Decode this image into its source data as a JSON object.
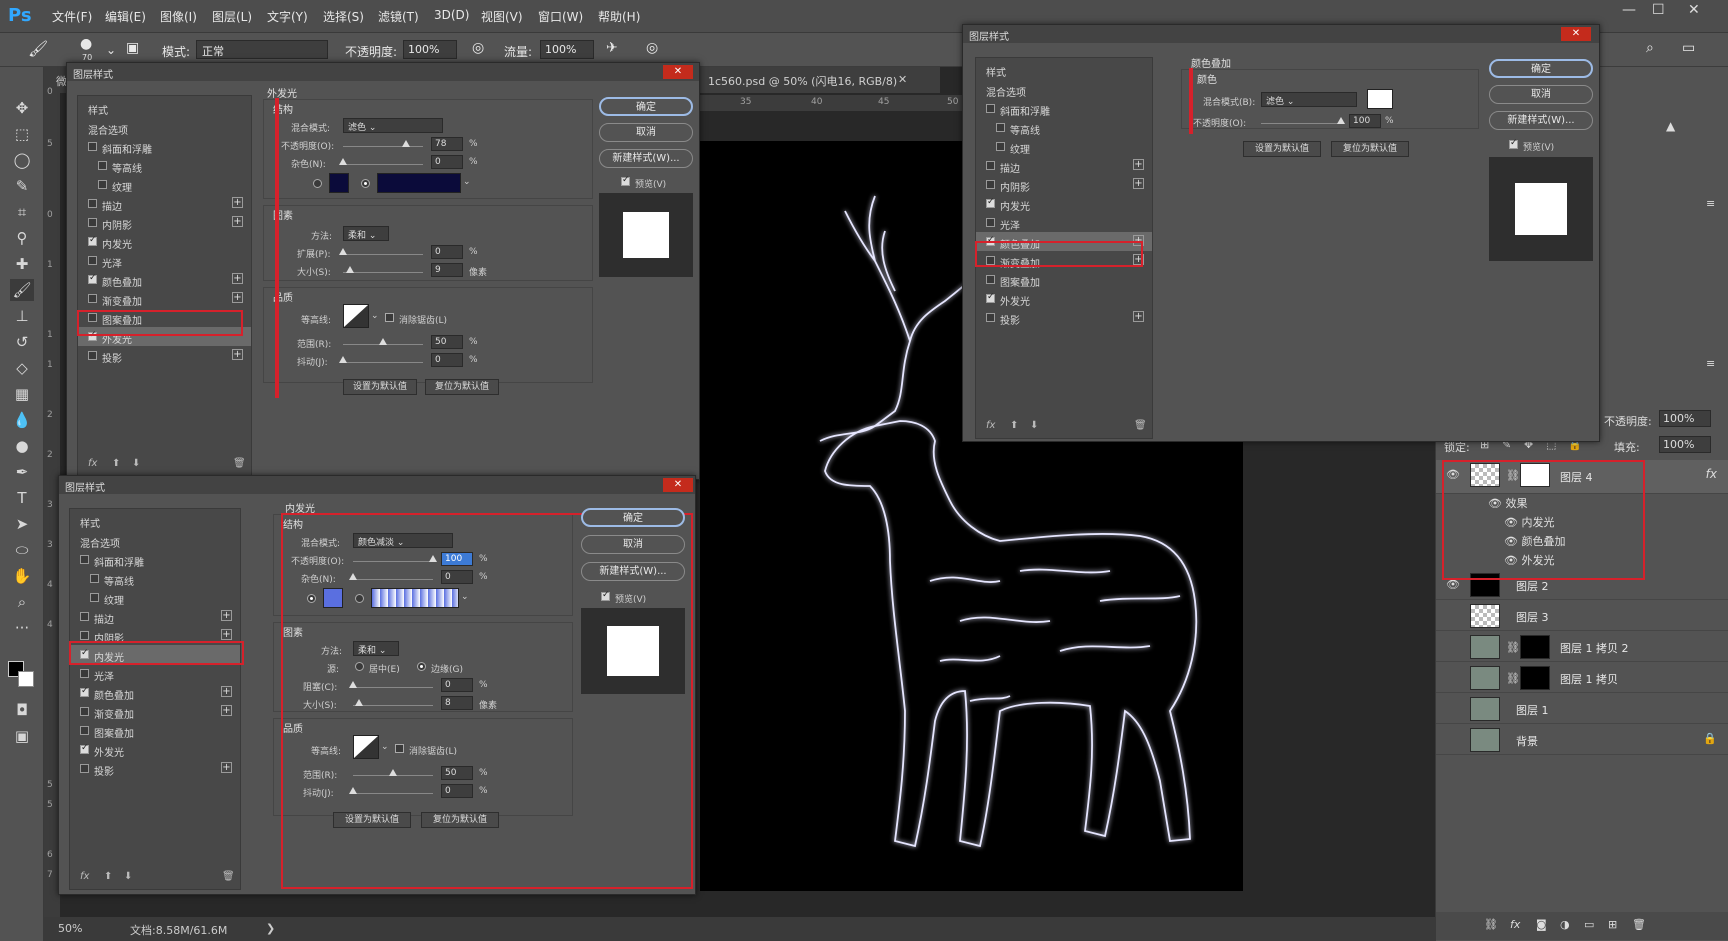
{
  "app": {
    "logo": "Ps",
    "accent": "#31a8ff"
  },
  "menu": [
    "文件(F)",
    "编辑(E)",
    "图像(I)",
    "图层(L)",
    "文字(Y)",
    "选择(S)",
    "滤镜(T)",
    "3D(D)",
    "视图(V)",
    "窗口(W)",
    "帮助(H)"
  ],
  "window_controls": [
    "—",
    "☐",
    "✕"
  ],
  "options": {
    "brush_size": "70",
    "mode_label": "模式:",
    "mode_value": "正常",
    "opacity_label": "不透明度:",
    "opacity_value": "100%",
    "flow_label": "流量:",
    "flow_value": "100%"
  },
  "document": {
    "tab_title": "1c560.psd @ 50% (闪电16, RGB/8)",
    "tab_prefix": "微",
    "ruler_h": [
      "35",
      "40",
      "45",
      "50"
    ],
    "ruler_v": [
      "0",
      "5",
      "0",
      "1",
      "1",
      "1",
      "2",
      "2",
      "3",
      "3",
      "4",
      "4",
      "5",
      "5",
      "6",
      "7"
    ]
  },
  "status": {
    "zoom": "50%",
    "doc_size": "文档:8.58M/61.6M",
    "arrow": "❯"
  },
  "style_items": [
    "样式",
    "混合选项",
    "斜面和浮雕",
    "等高线",
    "纹理",
    "描边",
    "内阴影",
    "内发光",
    "光泽",
    "颜色叠加",
    "渐变叠加",
    "图案叠加",
    "外发光",
    "投影"
  ],
  "buttons": {
    "ok": "确定",
    "cancel": "取消",
    "new_style": "新建样式(W)...",
    "preview": "预览(V)",
    "set_default": "设置为默认值",
    "reset_default": "复位为默认值"
  },
  "dialog_outer": {
    "title": "图层样式",
    "section": "外发光",
    "structure": "结构",
    "blend_label": "混合模式:",
    "blend_value": "滤色",
    "opacity_label": "不透明度(O):",
    "opacity_value": "78",
    "noise_label": "杂色(N):",
    "noise_value": "0",
    "color_fill": "#0b0b3a",
    "elements": "图素",
    "method_label": "方法:",
    "method_value": "柔和",
    "spread_label": "扩展(P):",
    "spread_value": "0",
    "size_label": "大小(S):",
    "size_value": "9",
    "unit_px": "像素",
    "quality": "品质",
    "contour_label": "等高线:",
    "antialias_label": "消除锯齿(L)",
    "range_label": "范围(R):",
    "range_value": "50",
    "jitter_label": "抖动(J):",
    "jitter_value": "0",
    "percent": "%"
  },
  "dialog_inner": {
    "title": "图层样式",
    "section": "内发光",
    "structure": "结构",
    "blend_label": "混合模式:",
    "blend_value": "颜色减淡",
    "opacity_label": "不透明度(O):",
    "opacity_value": "100",
    "noise_label": "杂色(N):",
    "noise_value": "0",
    "color_swatch": "#5a6fe0",
    "elements": "图素",
    "method_label": "方法:",
    "method_value": "柔和",
    "source_label": "源:",
    "source_center": "居中(E)",
    "source_edge": "边缘(G)",
    "choke_label": "阻塞(C):",
    "choke_value": "0",
    "size_label": "大小(S):",
    "size_value": "8",
    "unit_px": "像素",
    "quality": "品质",
    "contour_label": "等高线:",
    "antialias_label": "消除锯齿(L)",
    "range_label": "范围(R):",
    "range_value": "50",
    "jitter_label": "抖动(J):",
    "jitter_value": "0",
    "percent": "%"
  },
  "dialog_color": {
    "title": "图层样式",
    "section": "颜色叠加",
    "color": "颜色",
    "blend_label": "混合模式(B):",
    "blend_value": "滤色",
    "opacity_label": "不透明度(O):",
    "opacity_value": "100",
    "percent": "%",
    "swatch": "#ffffff"
  },
  "layers_panel": {
    "opacity_label": "不透明度:",
    "opacity_value": "100%",
    "lock_label": "锁定:",
    "fill_label": "填充:",
    "fill_value": "100%",
    "layer4": "图层 4",
    "effects_label": "效果",
    "effects": [
      "内发光",
      "颜色叠加",
      "外发光"
    ],
    "layers": [
      "图层 2",
      "图层 3",
      "图层 1 拷贝 2",
      "图层 1 拷贝",
      "图层 1",
      "背景"
    ]
  }
}
